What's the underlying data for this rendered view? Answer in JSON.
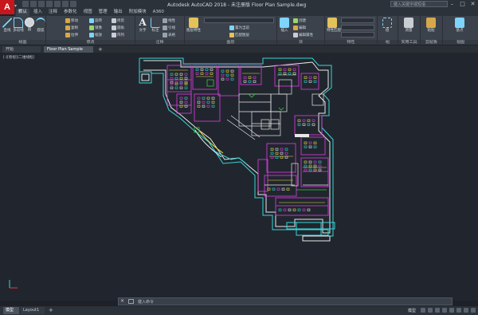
{
  "app": {
    "logo_letter": "A",
    "title": "Autodesk AutoCAD 2018 - 未注册版    Floor Plan Sample.dwg",
    "search_placeholder": "键入关键字或短语",
    "window_controls": [
      "minimize-icon",
      "maximize-icon",
      "close-icon"
    ]
  },
  "ribbon": {
    "tabs": [
      "默认",
      "插入",
      "注释",
      "参数化",
      "视图",
      "管理",
      "输出",
      "附加模块",
      "A360"
    ],
    "active_tab": 0,
    "panels": {
      "draw": {
        "label": "绘图",
        "tools": [
          "直线",
          "多段线",
          "圆",
          "圆弧"
        ]
      },
      "modify": {
        "label": "修改",
        "tools": [
          "移动",
          "旋转",
          "修剪",
          "复制",
          "镜像",
          "圆角",
          "拉伸",
          "缩放",
          "阵列"
        ]
      },
      "annotation": {
        "label": "注释",
        "tools": [
          "文字",
          "标注",
          "线性",
          "引线",
          "表格"
        ]
      },
      "layers": {
        "label": "图层",
        "tools": [
          "图层特性",
          "置为当前",
          "匹配图层"
        ]
      },
      "block": {
        "label": "块",
        "tools": [
          "插入",
          "创建",
          "编辑",
          "编辑属性"
        ]
      },
      "properties": {
        "label": "特性",
        "tools": [
          "特性匹配"
        ]
      },
      "groups": {
        "label": "组",
        "tools": [
          "组"
        ]
      },
      "utilities": {
        "label": "实用工具",
        "tools": [
          "测量"
        ]
      },
      "clipboard": {
        "label": "剪贴板",
        "tools": [
          "粘贴"
        ]
      },
      "view": {
        "label": "视图",
        "tools": [
          "基点"
        ]
      }
    }
  },
  "document_tabs": [
    "开始",
    "Floor Plan Sample"
  ],
  "viewport_label": "[-][俯视][二维线框]",
  "command_line": {
    "placeholder": "键入命令"
  },
  "status_bar": {
    "layout_tabs": [
      "模型",
      "Layout1"
    ],
    "mode": "模型"
  },
  "colors": {
    "background": "#21262e",
    "ribbon": "#3b424b",
    "accent_red": "#c8161d",
    "cad_magenta": "#e23ce6",
    "cad_cyan": "#35d6d6",
    "cad_white": "#e8e8e8",
    "cad_yellow": "#e8e04a",
    "cad_green": "#38c83a"
  }
}
